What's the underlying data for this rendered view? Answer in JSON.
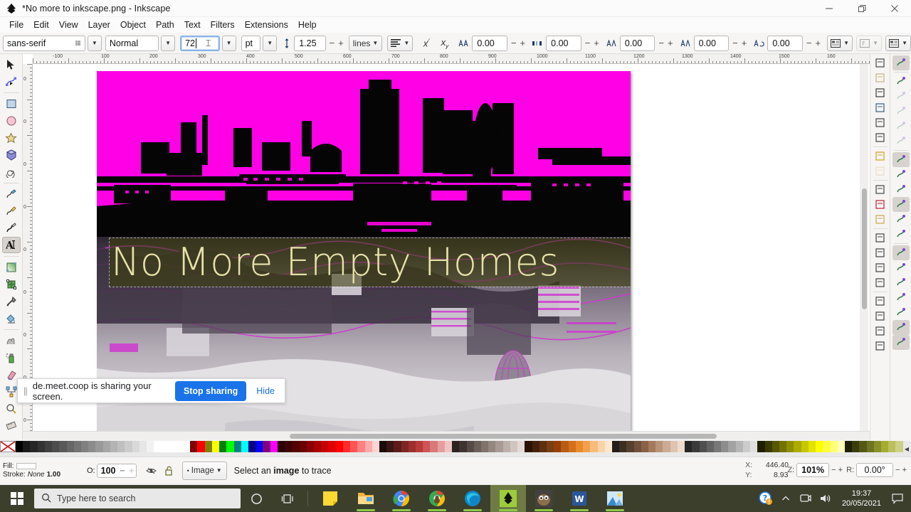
{
  "window": {
    "title": "*No more to inkscape.png - Inkscape",
    "app_icon": "inkscape-logo-icon",
    "controls": {
      "minimize": "minimize-icon",
      "maximize": "maximize-icon",
      "close": "close-icon"
    }
  },
  "menubar": {
    "items": [
      "File",
      "Edit",
      "View",
      "Layer",
      "Object",
      "Path",
      "Text",
      "Filters",
      "Extensions",
      "Help"
    ]
  },
  "text_toolbar": {
    "font_family": "sans-serif",
    "font_style": "Normal",
    "font_size": "72",
    "font_size_unit": "pt",
    "line_spacing": "1.25",
    "line_spacing_unit": "lines",
    "superscript": "superscript-icon",
    "subscript": "subscript-icon",
    "letter_spacing": "0.00",
    "word_spacing": "0.00",
    "horizontal_kerning": "0.00",
    "vertical_kerning": "0.00",
    "character_rotation": "0.00",
    "writing_mode": "horizontal-text-icon",
    "text_orientation": "text-orientation-icon",
    "text_direction": "text-direction-icon",
    "align_mode": "align-left-icon"
  },
  "toolbox": {
    "tools": [
      {
        "name": "selector-tool",
        "icon": "arrow-cursor-icon",
        "active": false
      },
      {
        "name": "node-tool",
        "icon": "node-editor-icon",
        "active": false
      },
      {
        "name": "rectangle-tool",
        "icon": "square-icon",
        "active": false
      },
      {
        "name": "ellipse-tool",
        "icon": "circle-icon",
        "active": false
      },
      {
        "name": "star-tool",
        "icon": "star-icon",
        "active": false
      },
      {
        "name": "3dbox-tool",
        "icon": "cube-icon",
        "active": false
      },
      {
        "name": "spiral-tool",
        "icon": "spiral-icon",
        "active": false
      },
      {
        "name": "pencil-tool",
        "icon": "pencil-icon",
        "active": false
      },
      {
        "name": "pen-tool",
        "icon": "bezier-pen-icon",
        "active": false
      },
      {
        "name": "calligraphy-tool",
        "icon": "calligraphy-icon",
        "active": false
      },
      {
        "name": "text-tool",
        "icon": "text-a-icon",
        "active": true
      },
      {
        "name": "gradient-tool",
        "icon": "gradient-icon",
        "active": false
      },
      {
        "name": "mesh-tool",
        "icon": "mesh-gradient-icon",
        "active": false
      },
      {
        "name": "dropper-tool",
        "icon": "eyedropper-icon",
        "active": false
      },
      {
        "name": "paint-bucket-tool",
        "icon": "paint-bucket-icon",
        "active": false
      },
      {
        "name": "tweak-tool",
        "icon": "tweak-hand-icon",
        "active": false
      },
      {
        "name": "spray-tool",
        "icon": "spray-can-icon",
        "active": false
      },
      {
        "name": "eraser-tool",
        "icon": "eraser-icon",
        "active": false
      },
      {
        "name": "connector-tool",
        "icon": "connector-icon",
        "active": false
      },
      {
        "name": "zoom-tool",
        "icon": "magnifier-icon",
        "active": false
      },
      {
        "name": "measure-tool",
        "icon": "ruler-icon",
        "active": false
      }
    ]
  },
  "canvas": {
    "ruler_h_labels": [
      "-100",
      "100",
      "200",
      "300",
      "400",
      "500",
      "600",
      "700",
      "800",
      "900",
      "1000",
      "1100",
      "1200",
      "1300",
      "1400",
      "1500",
      "160"
    ],
    "artwork_text": "No More Empty Homes",
    "artwork_text_color": "#e6e2a8",
    "artwork_band_color": "#3c3e0a",
    "artwork_top_color": "#ff00e6",
    "artwork_name": "no-more-empty-homes-poster"
  },
  "screen_share": {
    "grip": "drag-grip-icon",
    "message": "de.meet.coop is sharing your screen.",
    "stop_label": "Stop sharing",
    "hide_label": "Hide",
    "accent": "#1a73e8"
  },
  "statusbar": {
    "fill_label": "Fill:",
    "stroke_label": "Stroke:",
    "stroke_value": "None",
    "stroke_width": "1.00",
    "opacity_label": "O:",
    "opacity_value": "100",
    "layer_visibility_icon": "eye-hidden-icon",
    "layer_lock_icon": "unlock-icon",
    "layer_name": "Image",
    "hint": "Select an image to trace",
    "hint_prefix": "Select an ",
    "hint_bold": "image",
    "hint_suffix": " to trace",
    "x_label": "X:",
    "x_value": "446.40",
    "y_label": "Y:",
    "y_value": "8.93",
    "zoom_label": "Z:",
    "zoom_value": "101%",
    "rotation_label": "R:",
    "rotation_value": "0.00°"
  },
  "right_dock": {
    "items": [
      {
        "name": "new-document-icon",
        "active": false
      },
      {
        "name": "open-document-icon",
        "active": false
      },
      {
        "name": "save-document-icon",
        "active": false
      },
      {
        "name": "print-icon",
        "active": false
      },
      {
        "name": "import-icon",
        "active": false
      },
      {
        "name": "export-icon",
        "active": false
      },
      {
        "name": "undo-icon",
        "active": false
      },
      {
        "name": "redo-icon",
        "active": false,
        "dim": true
      },
      {
        "name": "copy-icon",
        "active": false
      },
      {
        "name": "cut-icon",
        "active": false
      },
      {
        "name": "paste-icon",
        "active": false
      },
      {
        "name": "zoom-in-icon",
        "active": false
      },
      {
        "name": "zoom-selection-icon",
        "active": false
      },
      {
        "name": "zoom-drawing-icon",
        "active": false
      },
      {
        "name": "zoom-page-icon",
        "active": false
      },
      {
        "name": "duplicate-icon",
        "active": false
      },
      {
        "name": "clone-icon",
        "active": false
      },
      {
        "name": "unlink-clone-icon",
        "active": false
      },
      {
        "name": "group-icon",
        "active": false
      }
    ]
  },
  "snap_bar": {
    "items": [
      {
        "name": "enable-snapping-icon",
        "active": true
      },
      {
        "name": "snap-bounding-box-icon",
        "active": false
      },
      {
        "name": "snap-bbox-corner-icon",
        "active": false,
        "dim": true
      },
      {
        "name": "snap-bbox-edge-icon",
        "active": false,
        "dim": true
      },
      {
        "name": "snap-bbox-midpoint-icon",
        "active": false,
        "dim": true
      },
      {
        "name": "snap-bbox-center-icon",
        "active": false,
        "dim": true
      },
      {
        "name": "snap-nodes-icon",
        "active": true
      },
      {
        "name": "snap-path-icon",
        "active": false
      },
      {
        "name": "snap-path-intersection-icon",
        "active": false
      },
      {
        "name": "snap-cusp-node-icon",
        "active": true
      },
      {
        "name": "snap-smooth-node-icon",
        "active": false
      },
      {
        "name": "snap-midpoint-icon",
        "active": false
      },
      {
        "name": "snap-others-icon",
        "active": true
      },
      {
        "name": "snap-object-center-icon",
        "active": false
      },
      {
        "name": "snap-rotation-center-icon",
        "active": false
      },
      {
        "name": "snap-text-baseline-icon",
        "active": false
      },
      {
        "name": "snap-page-border-icon",
        "active": false
      },
      {
        "name": "snap-grid-icon",
        "active": true
      },
      {
        "name": "snap-guide-icon",
        "active": true
      }
    ]
  },
  "palette": {
    "none_swatch": "no-color-icon",
    "colors": [
      "#000000",
      "#1a1a1a",
      "#262626",
      "#333333",
      "#404040",
      "#4d4d4d",
      "#595959",
      "#666666",
      "#737373",
      "#808080",
      "#8c8c8c",
      "#999999",
      "#a6a6a6",
      "#b3b3b3",
      "#bfbfbf",
      "#cccccc",
      "#d9d9d9",
      "#e6e6e6",
      "#f2f2f2",
      "#ffffff",
      "#ffffff",
      "#ffffff",
      "#ffffff",
      "#ffffff",
      "#800000",
      "#ff0000",
      "#808000",
      "#ffff00",
      "#008000",
      "#00ff00",
      "#008080",
      "#00ffff",
      "#000080",
      "#0000ff",
      "#800080",
      "#ff00ff",
      "#2b0000",
      "#3d0000",
      "#520000",
      "#6b0000",
      "#8a0000",
      "#a80000",
      "#c40000",
      "#e00000",
      "#ff0000",
      "#ff2b2b",
      "#ff5555",
      "#ff8080",
      "#ffaaaa",
      "#ffd4d4",
      "#1a0b0b",
      "#3b1414",
      "#5c1b1b",
      "#7d2525",
      "#9e2e2e",
      "#b83a3a",
      "#cc5555",
      "#d97878",
      "#e59e9e",
      "#f0c4c4",
      "#2b2320",
      "#3d3330",
      "#554a45",
      "#6b5f59",
      "#80736c",
      "#948780",
      "#a89b95",
      "#bcb0aa",
      "#d0c5bf",
      "#e4dad5",
      "#2b1200",
      "#45210b",
      "#5e3010",
      "#7a3f12",
      "#963f0b",
      "#b85c12",
      "#d4701a",
      "#e88a2b",
      "#f2a04d",
      "#f7bc7a",
      "#fad4a8",
      "#fce8d0",
      "#241c18",
      "#3d2e24",
      "#573f2f",
      "#70503b",
      "#8a6147",
      "#a47a5e",
      "#b89378",
      "#cbab94",
      "#ddc3b0",
      "#eddccd",
      "#262626",
      "#3a3a3a",
      "#4f4f4f",
      "#636363",
      "#787878",
      "#8d8d8d",
      "#a2a2a2",
      "#b6b6b6",
      "#cbcbcb",
      "#e0e0e0",
      "#1f1f00",
      "#3b3b00",
      "#575700",
      "#737300",
      "#8f8f00",
      "#abab00",
      "#c7c700",
      "#e3e300",
      "#ffff00",
      "#ffff3d",
      "#ffff7a",
      "#ffffb8",
      "#1f2000",
      "#3a3c0a",
      "#555814",
      "#6f741e",
      "#8a9028",
      "#a5ac32",
      "#bcc05c",
      "#ccd086"
    ],
    "scroll_arrow": "palette-scroll-arrow-icon"
  },
  "taskbar": {
    "start_icon": "windows-start-icon",
    "search_placeholder": "Type here to search",
    "search_icon": "search-icon",
    "cortana_icon": "cortana-circle-icon",
    "taskview_icon": "task-view-icon",
    "apps": [
      {
        "name": "sticky-notes-icon",
        "running": false
      },
      {
        "name": "file-explorer-icon",
        "running": true
      },
      {
        "name": "chrome-icon",
        "running": true
      },
      {
        "name": "chrome-profile-icon",
        "running": true
      },
      {
        "name": "edge-icon",
        "running": true
      },
      {
        "name": "inkscape-icon",
        "running": true,
        "active": true
      },
      {
        "name": "gimp-icon",
        "running": true
      },
      {
        "name": "word-icon",
        "running": true
      },
      {
        "name": "photos-icon",
        "running": true
      }
    ],
    "tray": {
      "help_icon": "help-warning-icon",
      "chevron_icon": "show-hidden-icons-icon",
      "screenshare_icon": "screen-share-icon",
      "volume_icon": "volume-icon",
      "time": "19:37",
      "date": "20/05/2021",
      "action_center_icon": "action-center-icon"
    }
  }
}
